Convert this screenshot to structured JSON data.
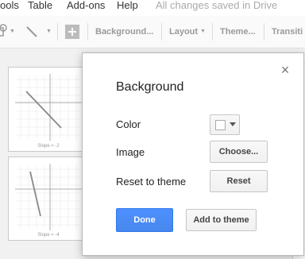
{
  "menubar": {
    "items": [
      "ools",
      "Table",
      "Add-ons",
      "Help"
    ],
    "status": "All changes saved in Drive"
  },
  "toolbar": {
    "background_label": "Background...",
    "layout_label": "Layout",
    "theme_label": "Theme...",
    "transition_label": "Transiti"
  },
  "slides": [
    {
      "caption": "Slope = -2"
    },
    {
      "caption": "Slope = -4"
    }
  ],
  "dialog": {
    "title": "Background",
    "color_label": "Color",
    "selected_color": "#ffffff",
    "image_label": "Image",
    "choose_button": "Choose...",
    "reset_label": "Reset to theme",
    "reset_button": "Reset",
    "done_button": "Done",
    "add_to_theme_button": "Add to theme",
    "close_glyph": "×"
  },
  "colors": {
    "primary_button": "#4d90fe",
    "dialog_border": "#b9b9b9",
    "menu_text": "#333333",
    "status_text": "#aaaaaa"
  }
}
